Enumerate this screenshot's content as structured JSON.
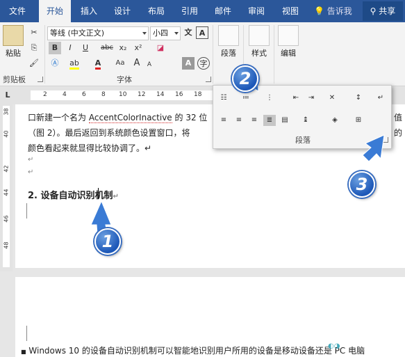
{
  "tabs": [
    "文件",
    "开始",
    "插入",
    "设计",
    "布局",
    "引用",
    "邮件",
    "审阅",
    "视图"
  ],
  "active_tab": "开始",
  "tell_me": "告诉我",
  "share": "共享",
  "clipboard": {
    "paste": "粘贴",
    "label": "剪贴板"
  },
  "font": {
    "name": "等线 (中文正文)",
    "size": "小四",
    "label": "字体",
    "bold": "B",
    "italic": "I",
    "underline": "U",
    "strike": "abc",
    "sub": "x₂",
    "sup": "x²",
    "wen": "文",
    "A": "A",
    "aa": "Aa",
    "a_big": "A",
    "a_small": "A"
  },
  "paragraph": {
    "label": "段落"
  },
  "styles": {
    "label": "样式"
  },
  "editing": {
    "label": "编辑"
  },
  "ruler_numbers": [
    "2",
    "4",
    "6",
    "8",
    "10",
    "12",
    "14",
    "16",
    "18"
  ],
  "vruler_numbers": [
    "38",
    "40",
    "42",
    "44",
    "46",
    "48"
  ],
  "document": {
    "line1a": "口新建一个名为",
    "line1b": "AccentColorInactive",
    "line1c": "的 32 位",
    "line1_end": "值",
    "line2": "（图 2）。最后返回到系统颜色设置窗口，将",
    "line2_end": "的",
    "line3": "颜色看起来就显得比较协调了。↵",
    "arrow1": "↵",
    "arrow2": "↵",
    "heading": "2.  设备自动识别机制",
    "heading_mark": "↵",
    "page2_line": "Windows 10 的设备自动识别机制可以智能地识别用户所用的设备是移动设备还是 PC 电脑"
  },
  "badges": [
    "1",
    "2",
    "3"
  ],
  "colors": {
    "accent": "#2b579a",
    "badge": "#1d58b8",
    "highlight": "#ffff00",
    "font_red": "#e02020"
  }
}
